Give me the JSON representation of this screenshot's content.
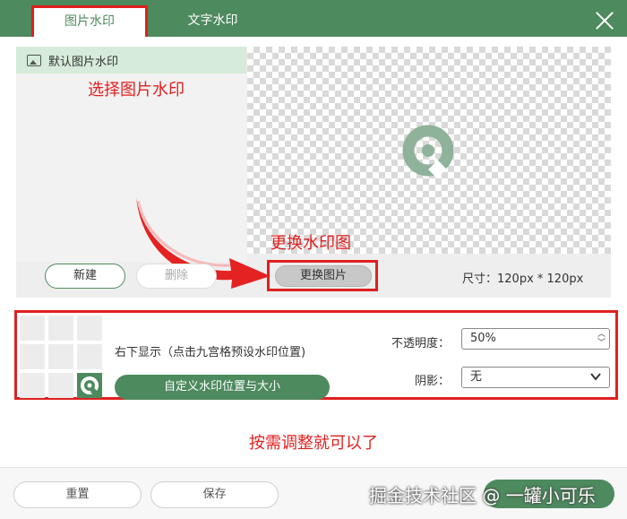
{
  "tabs": {
    "image_watermark": "图片水印",
    "text_watermark": "文字水印"
  },
  "list": {
    "items": [
      {
        "label": "默认图片水印"
      }
    ]
  },
  "annotations": {
    "select": "选择图片水印",
    "change": "更换水印图",
    "adjust": "按需调整就可以了"
  },
  "buttons": {
    "new": "新建",
    "delete": "删除",
    "change_image": "更换图片",
    "custom_position": "自定义水印位置与大小",
    "reset": "重置",
    "save": "保存"
  },
  "size": {
    "text": "尺寸：120px * 120px"
  },
  "position": {
    "text": "右下显示（点击九宫格预设水印位置)",
    "selected_cell": "bottom-right"
  },
  "opacity": {
    "label": "不透明度：",
    "value": "50%"
  },
  "shadow": {
    "label": "阴影：",
    "value": "无"
  },
  "watermark_overlay": "掘金技术社区 @ 一罐小可乐",
  "colors": {
    "accent": "#4d8a5e",
    "annotation": "#e02020"
  }
}
